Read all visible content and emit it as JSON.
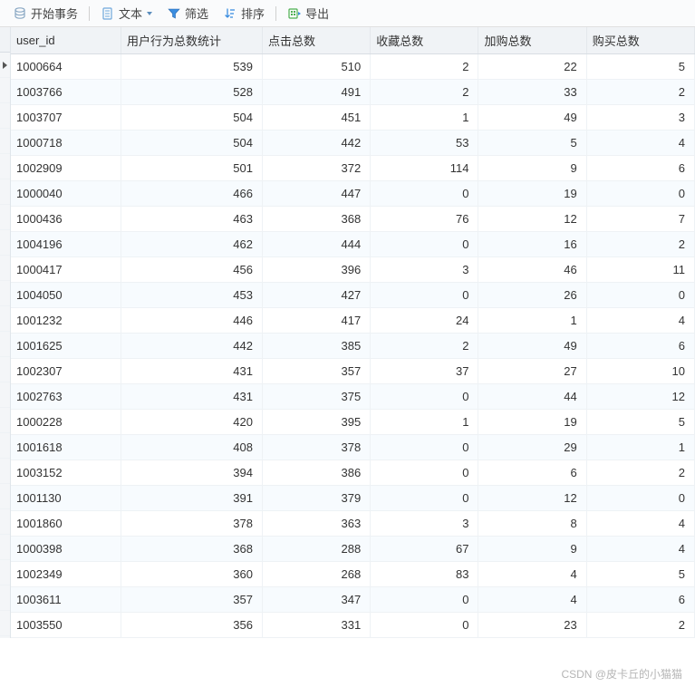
{
  "toolbar": {
    "begin_transaction": "开始事务",
    "text": "文本",
    "filter": "筛选",
    "sort": "排序",
    "export": "导出"
  },
  "columns": [
    "user_id",
    "用户行为总数统计",
    "点击总数",
    "收藏总数",
    "加购总数",
    "购买总数"
  ],
  "current_row_index": 0,
  "rows": [
    [
      "1000664",
      539,
      510,
      2,
      22,
      5
    ],
    [
      "1003766",
      528,
      491,
      2,
      33,
      2
    ],
    [
      "1003707",
      504,
      451,
      1,
      49,
      3
    ],
    [
      "1000718",
      504,
      442,
      53,
      5,
      4
    ],
    [
      "1002909",
      501,
      372,
      114,
      9,
      6
    ],
    [
      "1000040",
      466,
      447,
      0,
      19,
      0
    ],
    [
      "1000436",
      463,
      368,
      76,
      12,
      7
    ],
    [
      "1004196",
      462,
      444,
      0,
      16,
      2
    ],
    [
      "1000417",
      456,
      396,
      3,
      46,
      11
    ],
    [
      "1004050",
      453,
      427,
      0,
      26,
      0
    ],
    [
      "1001232",
      446,
      417,
      24,
      1,
      4
    ],
    [
      "1001625",
      442,
      385,
      2,
      49,
      6
    ],
    [
      "1002307",
      431,
      357,
      37,
      27,
      10
    ],
    [
      "1002763",
      431,
      375,
      0,
      44,
      12
    ],
    [
      "1000228",
      420,
      395,
      1,
      19,
      5
    ],
    [
      "1001618",
      408,
      378,
      0,
      29,
      1
    ],
    [
      "1003152",
      394,
      386,
      0,
      6,
      2
    ],
    [
      "1001130",
      391,
      379,
      0,
      12,
      0
    ],
    [
      "1001860",
      378,
      363,
      3,
      8,
      4
    ],
    [
      "1000398",
      368,
      288,
      67,
      9,
      4
    ],
    [
      "1002349",
      360,
      268,
      83,
      4,
      5
    ],
    [
      "1003611",
      357,
      347,
      0,
      4,
      6
    ],
    [
      "1003550",
      356,
      331,
      0,
      23,
      2
    ]
  ],
  "watermark": "CSDN @皮卡丘的小猫猫"
}
